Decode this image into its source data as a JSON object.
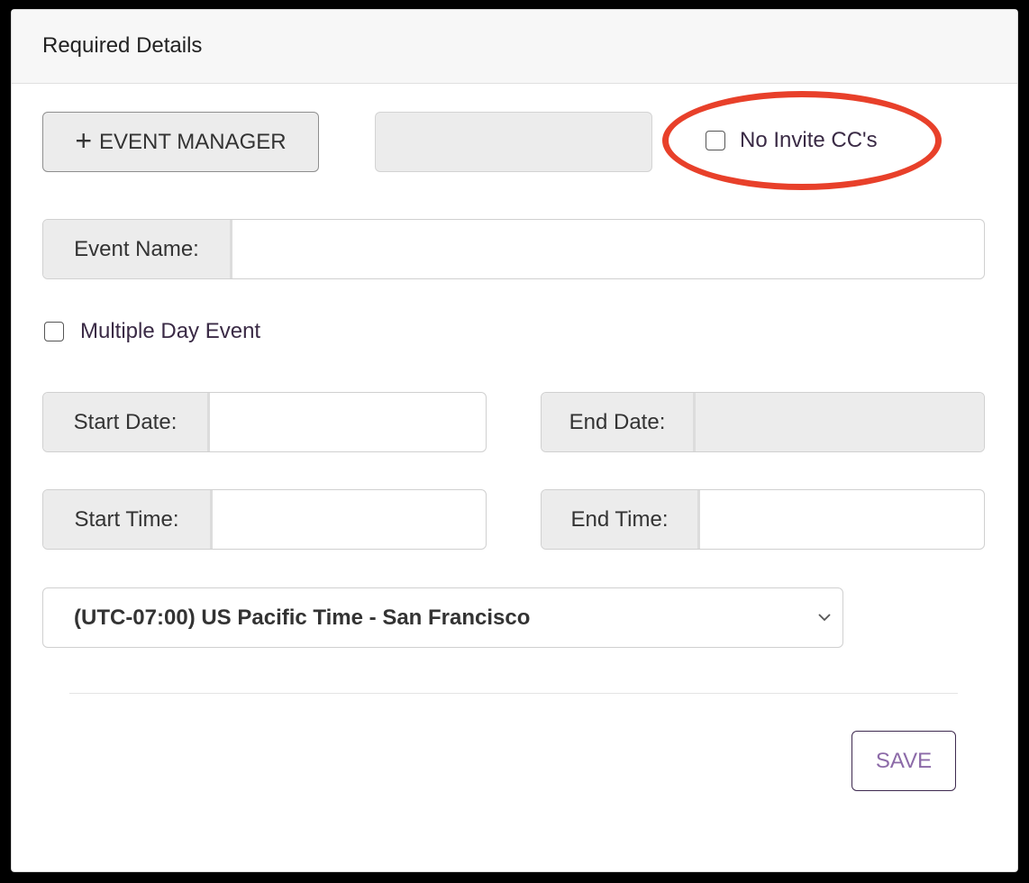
{
  "panel": {
    "title": "Required Details"
  },
  "event_manager_button": {
    "label": "EVENT MANAGER",
    "icon": "plus-icon"
  },
  "no_invite_cc": {
    "label": "No Invite CC's",
    "checked": false
  },
  "event_name": {
    "label": "Event Name:",
    "value": ""
  },
  "multiple_day": {
    "label": "Multiple Day Event",
    "checked": false
  },
  "start_date": {
    "label": "Start Date:",
    "value": ""
  },
  "end_date": {
    "label": "End Date:",
    "value": ""
  },
  "start_time": {
    "label": "Start Time:",
    "value": ""
  },
  "end_time": {
    "label": "End Time:",
    "value": ""
  },
  "timezone": {
    "selected": "(UTC-07:00) US Pacific Time - San Francisco"
  },
  "save_button": {
    "label": "SAVE"
  },
  "colors": {
    "highlight_ring": "#e8402a",
    "accent_purple": "#8c6aa8"
  }
}
